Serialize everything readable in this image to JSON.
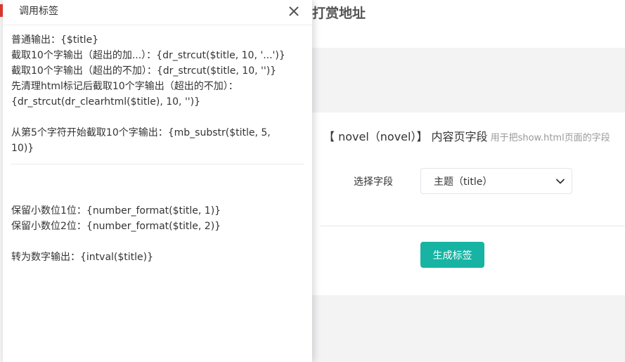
{
  "background": {
    "page_title": "打赏地址",
    "field_heading_prefix": "【 novel（novel）】 内容页字段",
    "field_heading_hint": "用于把show.html页面的字段",
    "select_label": "选择字段",
    "select_value": "主题（title）",
    "generate_button": "生成标签"
  },
  "modal": {
    "title": "调用标签",
    "close_icon": "close-icon",
    "group1": [
      "普通输出：{$title}",
      "截取10个字输出（超出的加...）：{dr_strcut($title, 10, '...')}",
      "截取10个字输出（超出的不加）：{dr_strcut($title, 10, '')}",
      "先清理html标记后截取10个字输出（超出的不加）：",
      "{dr_strcut(dr_clearhtml($title), 10, '')}"
    ],
    "group2": [
      "从第5个字符开始截取10个字输出：{mb_substr($title, 5,",
      "10)}"
    ],
    "group3": [
      "保留小数位1位：{number_format($title, 1)}",
      "保留小数位2位：{number_format($title, 2)}"
    ],
    "group4": [
      "转为数字输出：{intval($title)}"
    ]
  },
  "colors": {
    "accent": "#17b3a3",
    "page_bg": "#f3f3f4",
    "red_fragment": "#e23a30"
  }
}
